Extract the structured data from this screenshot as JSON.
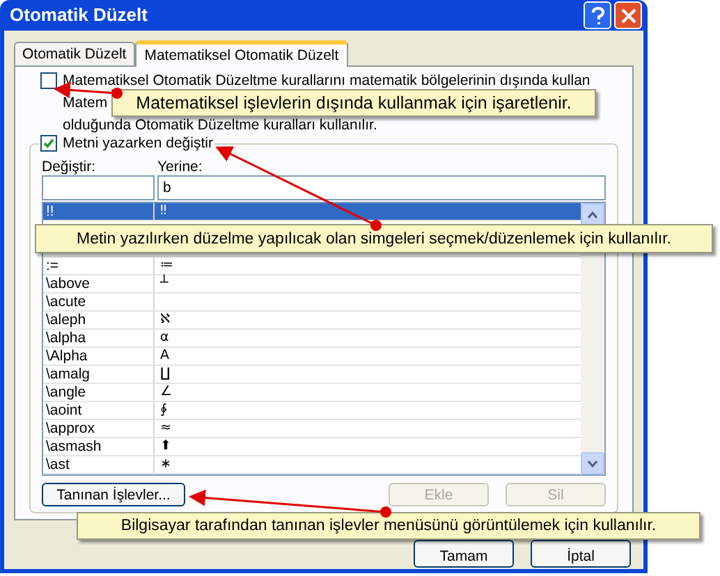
{
  "window": {
    "title": "Otomatik Düzelt"
  },
  "tabs": [
    {
      "label": "Otomatik Düzelt",
      "selected": false
    },
    {
      "label": "Matematiksel Otomatik Düzelt",
      "selected": true
    }
  ],
  "outside_math": {
    "checked": false,
    "label": "Matematiksel Otomatik Düzeltme kurallarını matematik bölgelerinin dışında kullan",
    "description_lines": [
      "Matem",
      "olduğunda Otomatik Düzeltme kuralları kullanılır."
    ]
  },
  "replace_while_typing": {
    "checked": true,
    "label": "Metni yazarken değiştir"
  },
  "replace_label": "Değiştir:",
  "with_label": "Yerine:",
  "with_field": {
    "value": "b"
  },
  "rows": [
    {
      "replace": "!!",
      "with": "‼",
      "selected": true
    },
    {
      "replace": ":=",
      "with": "≔",
      "selected": false
    },
    {
      "replace": "\\above",
      "with": "┴",
      "selected": false
    },
    {
      "replace": "\\acute",
      "selected": false
    },
    {
      "replace": "\\aleph",
      "with": "ℵ",
      "selected": false
    },
    {
      "replace": "\\alpha",
      "with": "α",
      "selected": false
    },
    {
      "replace": "\\Alpha",
      "with": "Α",
      "selected": false
    },
    {
      "replace": "\\amalg",
      "with": "∐",
      "selected": false
    },
    {
      "replace": "\\angle",
      "with": "∠",
      "selected": false
    },
    {
      "replace": "\\aoint",
      "with": "∳",
      "selected": false
    },
    {
      "replace": "\\approx",
      "with": "≈",
      "selected": false
    },
    {
      "replace": "\\asmash",
      "with": "⬆",
      "selected": false
    },
    {
      "replace": "\\ast",
      "with": "∗",
      "selected": false
    }
  ],
  "panel_buttons": [
    {
      "label": "Tanınan İşlevler...",
      "disabled": false
    },
    {
      "label": "Ekle",
      "disabled": true
    },
    {
      "label": "Sil",
      "disabled": true
    }
  ],
  "dialog_buttons": [
    {
      "label": "Tamam"
    },
    {
      "label": "İptal"
    }
  ],
  "callouts": [
    {
      "text": "Matematiksel işlevlerin dışında kullanmak için işaretlenir."
    },
    {
      "text": "Metin yazılırken düzelme yapılıcak olan simgeleri seçmek/düzenlemek için kullanılır."
    },
    {
      "text": "Bilgisayar tarafından tanınan işlevler menüsünü görüntülemek için kullanılır."
    }
  ]
}
